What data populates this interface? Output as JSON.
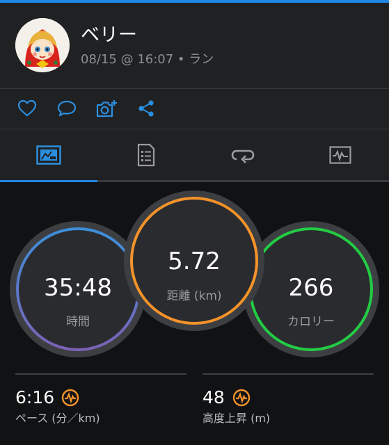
{
  "header": {
    "user_name": "ベリー",
    "meta": "08/15 @ 16:07 • ラン"
  },
  "actions": [
    "heart-icon",
    "comment-icon",
    "add-photo-icon",
    "share-icon"
  ],
  "tabs": [
    {
      "icon": "stats-icon",
      "active": true
    },
    {
      "icon": "details-icon",
      "active": false
    },
    {
      "icon": "laps-icon",
      "active": false
    },
    {
      "icon": "charts-icon",
      "active": false
    }
  ],
  "stats": {
    "time": {
      "value": "35:48",
      "label": "時間"
    },
    "distance": {
      "value": "5.72",
      "label": "距離 (km)"
    },
    "calories": {
      "value": "266",
      "label": "カロリー"
    }
  },
  "summary": {
    "pace": {
      "value": "6:16",
      "label": "ペース (分／km)"
    },
    "elevation": {
      "value": "48",
      "label": "高度上昇 (m)"
    }
  },
  "colors": {
    "accent": "#1e88e5",
    "time_ring": "#5a82c8",
    "distance_ring": "#f5932a",
    "calories_ring": "#22cc44"
  }
}
